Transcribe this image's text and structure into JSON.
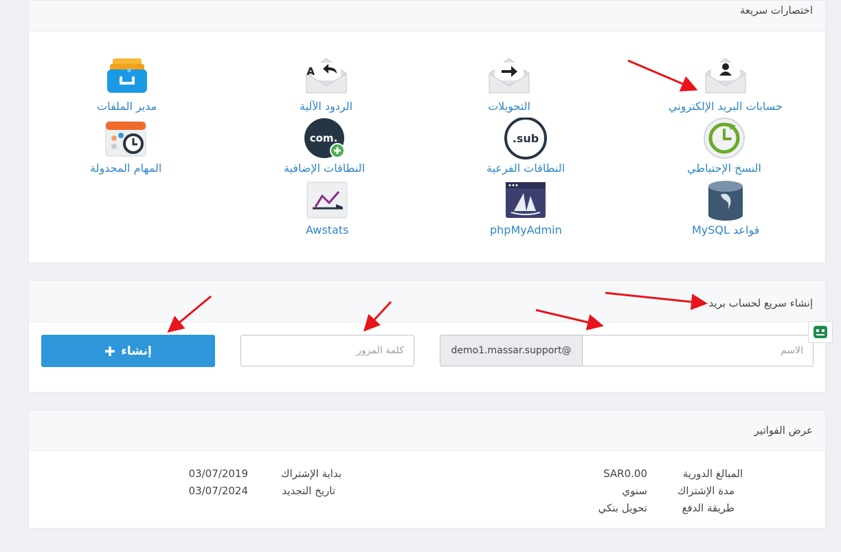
{
  "shortcuts": {
    "title": "اختصارات سريعة",
    "items": [
      {
        "id": "email-accounts",
        "label": "حسابات البريد الإلكتروني",
        "icon": "envelope-user-icon"
      },
      {
        "id": "forwarders",
        "label": "التحويلات",
        "icon": "envelope-forward-icon"
      },
      {
        "id": "autoresponders",
        "label": "الردود الآلية",
        "icon": "envelope-reply-icon"
      },
      {
        "id": "file-manager",
        "label": "مدير الملفات",
        "icon": "file-drawer-icon"
      },
      {
        "id": "backup",
        "label": "النسخ الإحتياطي",
        "icon": "backup-clock-icon"
      },
      {
        "id": "subdomains",
        "label": "النطاقات الفرعية",
        "icon": "subdomain-icon"
      },
      {
        "id": "addon-domains",
        "label": "النطاقات الإضافية",
        "icon": "addon-domain-icon"
      },
      {
        "id": "cron-jobs",
        "label": "المهام المجدولة",
        "icon": "calendar-clock-icon"
      },
      {
        "id": "mysql",
        "label": "قواعد MySQL",
        "icon": "mysql-database-icon"
      },
      {
        "id": "phpmyadmin",
        "label": "phpMyAdmin",
        "icon": "phpmyadmin-icon"
      },
      {
        "id": "awstats",
        "label": "Awstats",
        "icon": "stats-chart-icon"
      }
    ]
  },
  "quick_email": {
    "title": "إنشاء سريع لحساب بريد",
    "name_placeholder": "الاسم",
    "domain": "demo1.massar.support@",
    "password_placeholder": "كلمة المرور",
    "create_label": "إنشاء",
    "create_icon": "plus-icon"
  },
  "invoices": {
    "title": "عرض الفواتير",
    "right": [
      {
        "label": "المبالغ الدورية",
        "value": "SAR0.00"
      },
      {
        "label": "مدة الإشتراك",
        "value": "سنوي"
      },
      {
        "label": "طريقة الدفع",
        "value": "تحويل بنكي"
      }
    ],
    "left": [
      {
        "label": "بداية الإشتراك",
        "value": "03/07/2019"
      },
      {
        "label": "تاريخ التجديد",
        "value": "03/07/2024"
      }
    ]
  },
  "colors": {
    "accent": "#2f96d9",
    "link": "#2f86c6",
    "annotation": "#e8141b"
  }
}
